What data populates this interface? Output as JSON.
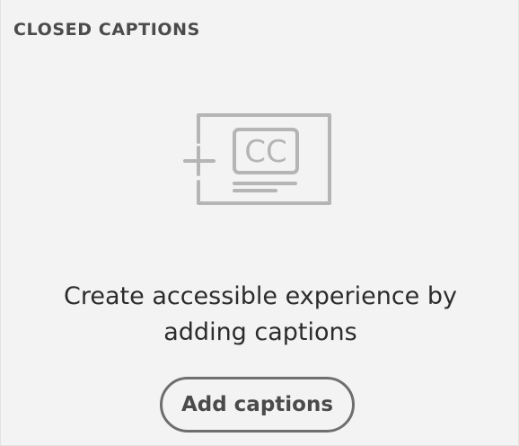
{
  "panel": {
    "title": "CLOSED CAPTIONS"
  },
  "illustration": {
    "icon": "closed-captions-add-icon",
    "badge_text": "CC",
    "stroke_color": "#b5b5b5"
  },
  "empty_state": {
    "line1": "Create accessible experience by",
    "line2": "adding captions"
  },
  "actions": {
    "add_captions_label": "Add captions"
  }
}
